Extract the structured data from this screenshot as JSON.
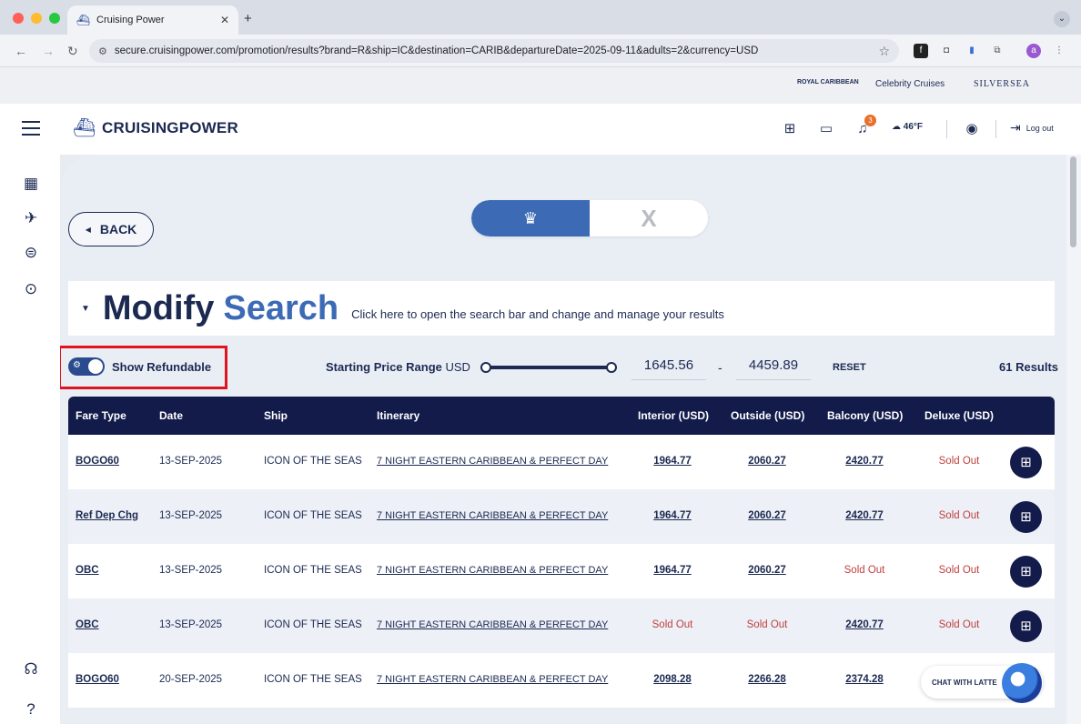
{
  "browser": {
    "tab_title": "Cruising Power",
    "url": "secure.cruisingpower.com/promotion/results?brand=R&ship=IC&destination=CARIB&departureDate=2025-09-11&adults=2&currency=USD",
    "profile_initial": "a"
  },
  "brands": {
    "royal": "ROYAL CARIBBEAN",
    "celebrity": "Celebrity Cruises",
    "silversea": "SILVERSEA"
  },
  "header": {
    "logo_text": "CRUISINGPOWER",
    "notification_count": "3",
    "weather": "46°F",
    "logout": "Log out"
  },
  "main": {
    "back_label": "BACK",
    "brand_toggle": {
      "active_icon": "royal-crown-anchor-icon",
      "inactive_label": "X"
    },
    "modify": {
      "word1": "Modify",
      "word2": "Search",
      "hint": "Click here to open the search bar and change and manage your results"
    },
    "filters": {
      "refundable_label": "Show Refundable",
      "refundable_on": true,
      "range_label_bold": "Starting Price Range",
      "range_currency": "USD",
      "min_price": "1645.56",
      "max_price": "4459.89",
      "dash": "-",
      "reset": "RESET",
      "results": "61 Results"
    },
    "table": {
      "headers": [
        "Fare Type",
        "Date",
        "Ship",
        "Itinerary",
        "Interior (USD)",
        "Outside (USD)",
        "Balcony (USD)",
        "Deluxe (USD)"
      ],
      "rows": [
        {
          "fare": "BOGO60",
          "date": "13-SEP-2025",
          "ship": "ICON OF THE SEAS",
          "itin": "7 NIGHT EASTERN CARIBBEAN & PERFECT DAY",
          "interior": "1964.77",
          "outside": "2060.27",
          "balcony": "2420.77",
          "deluxe": "Sold Out"
        },
        {
          "fare": "Ref Dep Chg",
          "date": "13-SEP-2025",
          "ship": "ICON OF THE SEAS",
          "itin": "7 NIGHT EASTERN CARIBBEAN & PERFECT DAY",
          "interior": "1964.77",
          "outside": "2060.27",
          "balcony": "2420.77",
          "deluxe": "Sold Out"
        },
        {
          "fare": "OBC",
          "date": "13-SEP-2025",
          "ship": "ICON OF THE SEAS",
          "itin": "7 NIGHT EASTERN CARIBBEAN & PERFECT DAY",
          "interior": "1964.77",
          "outside": "2060.27",
          "balcony": "Sold Out",
          "deluxe": "Sold Out"
        },
        {
          "fare": "OBC",
          "date": "13-SEP-2025",
          "ship": "ICON OF THE SEAS",
          "itin": "7 NIGHT EASTERN CARIBBEAN & PERFECT DAY",
          "interior": "Sold Out",
          "outside": "Sold Out",
          "balcony": "2420.77",
          "deluxe": "Sold Out"
        },
        {
          "fare": "BOGO60",
          "date": "20-SEP-2025",
          "ship": "ICON OF THE SEAS",
          "itin": "7 NIGHT EASTERN CARIBBEAN & PERFECT DAY",
          "interior": "2098.28",
          "outside": "2266.28",
          "balcony": "2374.28",
          "deluxe": ""
        }
      ]
    }
  },
  "chat": {
    "label": "CHAT WITH LATTE"
  }
}
